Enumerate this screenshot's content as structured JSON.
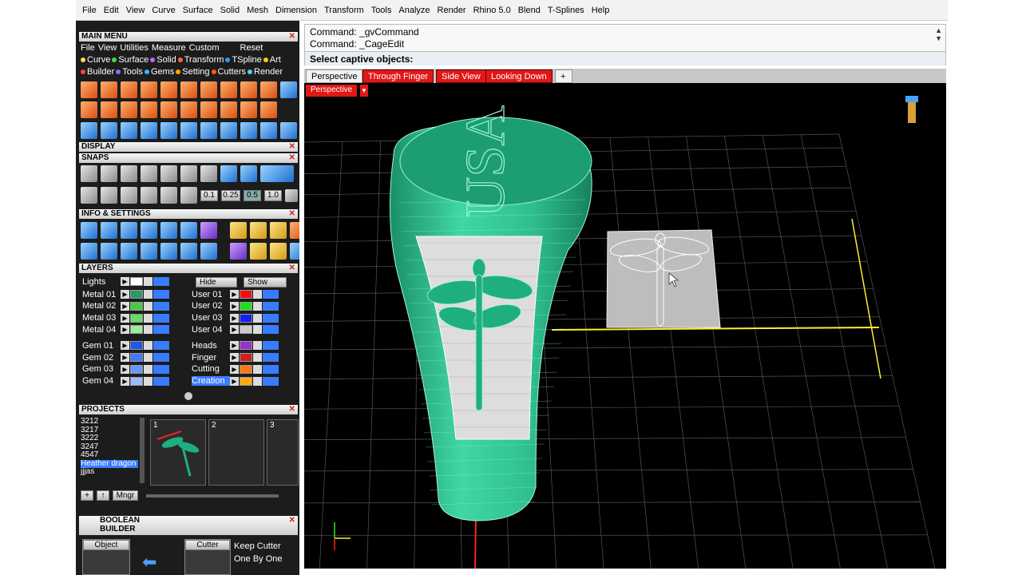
{
  "menubar": [
    "File",
    "Edit",
    "View",
    "Curve",
    "Surface",
    "Solid",
    "Mesh",
    "Dimension",
    "Transform",
    "Tools",
    "Analyze",
    "Render",
    "Rhino 5.0",
    "Blend",
    "T-Splines",
    "Help"
  ],
  "main_menu": {
    "title": "MAIN MENU",
    "row1": [
      "File",
      "View",
      "Utilities",
      "Measure",
      "Custom",
      "Reset"
    ],
    "row2": [
      {
        "label": "Curve",
        "color": "#ffdd55"
      },
      {
        "label": "Surface",
        "color": "#44dd44"
      },
      {
        "label": "Solid",
        "color": "#bb66ff"
      },
      {
        "label": "Transform",
        "color": "#ff6633"
      },
      {
        "label": "TSpline",
        "color": "#3399ff"
      },
      {
        "label": "Art",
        "color": "#ffcc00"
      }
    ],
    "row3": [
      {
        "label": "Builder",
        "color": "#ff4433"
      },
      {
        "label": "Tools",
        "color": "#9966ff"
      },
      {
        "label": "Gems",
        "color": "#33bbff"
      },
      {
        "label": "Setting",
        "color": "#ffaa00"
      },
      {
        "label": "Cutters",
        "color": "#ff5522"
      },
      {
        "label": "Render",
        "color": "#55ccff"
      }
    ]
  },
  "sections": {
    "display": "DISPLAY",
    "snaps": "SNAPS",
    "info": "INFO & SETTINGS",
    "layers": "LAYERS",
    "projects": "PROJECTS",
    "boolean": "BOOLEAN",
    "builder": "BUILDER"
  },
  "snaps": {
    "values": [
      "0.1",
      "0.25",
      "0.5",
      "1.0"
    ]
  },
  "layers": {
    "lights": "Lights",
    "hide": "Hide",
    "show": "Show",
    "left": [
      {
        "name": "Metal 01",
        "color": "#2a9a6a"
      },
      {
        "name": "Metal 02",
        "color": "#44cc44"
      },
      {
        "name": "Metal 03",
        "color": "#66dd66"
      },
      {
        "name": "Metal 04",
        "color": "#99ee99"
      },
      {
        "name": "Gem 01",
        "color": "#2255ee"
      },
      {
        "name": "Gem 02",
        "color": "#4477ff"
      },
      {
        "name": "Gem 03",
        "color": "#6699ff"
      },
      {
        "name": "Gem 04",
        "color": "#99bbff"
      }
    ],
    "right": [
      {
        "name": "User 01",
        "color": "#ee1111"
      },
      {
        "name": "User 02",
        "color": "#22dd22"
      },
      {
        "name": "User 03",
        "color": "#1122ee"
      },
      {
        "name": "User 04",
        "color": "#cccccc"
      },
      {
        "name": "Heads",
        "color": "#9933cc"
      },
      {
        "name": "Finger",
        "color": "#cc2222"
      },
      {
        "name": "Cutting",
        "color": "#ff7711"
      },
      {
        "name": "Creation",
        "color": "#ffaa11"
      }
    ]
  },
  "projects": {
    "list": [
      "3212",
      "3217",
      "3222",
      "3247",
      "4547",
      "Heather dragon",
      "jjjas"
    ],
    "selected": "Heather dragon",
    "thumbs": [
      "1",
      "2",
      "3"
    ],
    "mngr": "Mngr"
  },
  "boolean": {
    "object": "Object",
    "cutter": "Cutter",
    "keep": "Keep Cutter",
    "onebyone": "One By One"
  },
  "command": {
    "line1": "Command: _gvCommand",
    "line2": "Command: _CageEdit",
    "prompt": "Select captive objects:"
  },
  "tabs": [
    "Perspective",
    "Through Finger",
    "Side View",
    "Looking Down"
  ],
  "viewport": {
    "label": "Perspective",
    "logo_letters": "USA"
  },
  "colors": {
    "accent": "#e01818",
    "model": "#2fbf8f",
    "grid": "#555555",
    "axis_x": "#ff2222",
    "axis_y": "#ffee33",
    "axis_z": "#22ee22"
  }
}
